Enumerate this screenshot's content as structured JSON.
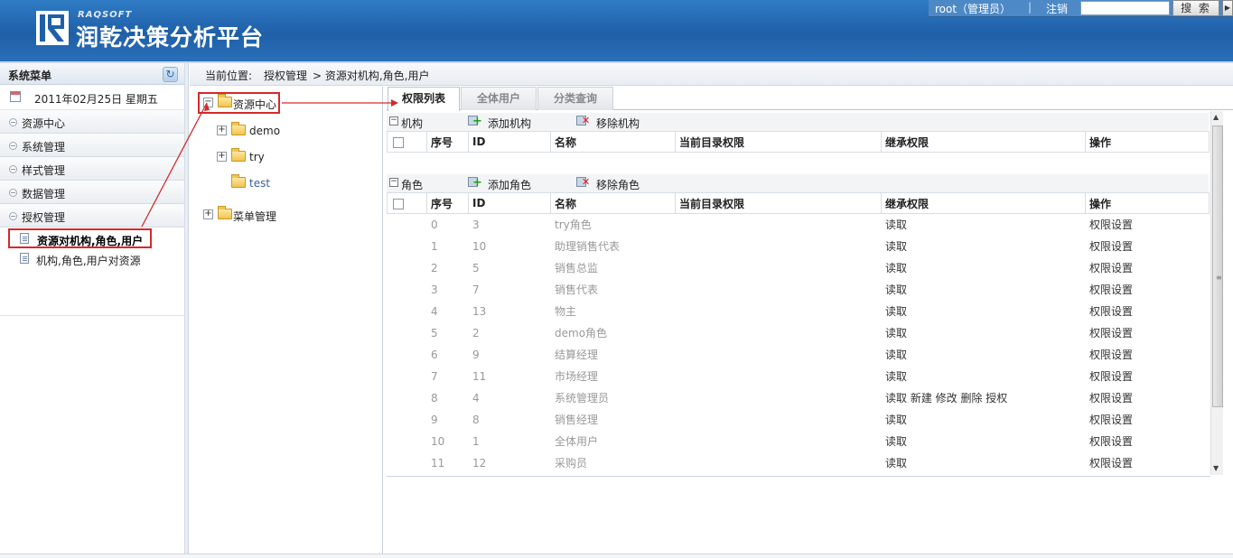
{
  "header": {
    "brand_small": "RAQSOFT",
    "brand_title": "润乾决策分析平台",
    "user": "root（管理员）",
    "separator": "|",
    "logout": "注销",
    "search_value": "",
    "search_button": "搜 索",
    "nav_arrow": "▶"
  },
  "sidebar": {
    "title": "系统菜单",
    "date": "2011年02月25日  星期五",
    "groups": [
      "资源中心",
      "系统管理",
      "样式管理",
      "数据管理",
      "授权管理"
    ],
    "sub_items": [
      "资源对机构,角色,用户",
      "机构,角色,用户对资源"
    ]
  },
  "breadcrumb": {
    "prefix": "当前位置:",
    "path1": "授权管理",
    "path2": "> 资源对机构,角色,用户"
  },
  "tree": {
    "root": "资源中心",
    "root_toggle": "−",
    "children": [
      "demo",
      "try",
      "test"
    ],
    "child_toggle": "+",
    "second_root": "菜单管理"
  },
  "tabs": [
    "权限列表",
    "全体用户",
    "分类查询"
  ],
  "org_section": {
    "title": "机构",
    "toggle": "−",
    "add": "添加机构",
    "remove": "移除机构"
  },
  "role_section": {
    "title": "角色",
    "toggle": "−",
    "add": "添加角色",
    "remove": "移除角色"
  },
  "columns": [
    "序号",
    "ID",
    "名称",
    "当前目录权限",
    "继承权限",
    "操作"
  ],
  "rows": [
    {
      "no": "0",
      "id": "3",
      "name": "try角色",
      "inherit": "读取",
      "op": "权限设置"
    },
    {
      "no": "1",
      "id": "10",
      "name": "助理销售代表",
      "inherit": "读取",
      "op": "权限设置"
    },
    {
      "no": "2",
      "id": "5",
      "name": "销售总监",
      "inherit": "读取",
      "op": "权限设置"
    },
    {
      "no": "3",
      "id": "7",
      "name": "销售代表",
      "inherit": "读取",
      "op": "权限设置"
    },
    {
      "no": "4",
      "id": "13",
      "name": "物主",
      "inherit": "读取",
      "op": "权限设置"
    },
    {
      "no": "5",
      "id": "2",
      "name": "demo角色",
      "inherit": "读取",
      "op": "权限设置"
    },
    {
      "no": "6",
      "id": "9",
      "name": "结算经理",
      "inherit": "读取",
      "op": "权限设置"
    },
    {
      "no": "7",
      "id": "11",
      "name": "市场经理",
      "inherit": "读取",
      "op": "权限设置"
    },
    {
      "no": "8",
      "id": "4",
      "name": "系统管理员",
      "inherit": "读取  新建  修改  删除  授权",
      "op": "权限设置"
    },
    {
      "no": "9",
      "id": "8",
      "name": "销售经理",
      "inherit": "读取",
      "op": "权限设置"
    },
    {
      "no": "10",
      "id": "1",
      "name": "全体用户",
      "inherit": "读取",
      "op": "权限设置"
    },
    {
      "no": "11",
      "id": "12",
      "name": "采购员",
      "inherit": "读取",
      "op": "权限设置"
    }
  ],
  "colors": {
    "header_blue": "#2f7cc4",
    "highlight_red": "#d42a2a"
  }
}
